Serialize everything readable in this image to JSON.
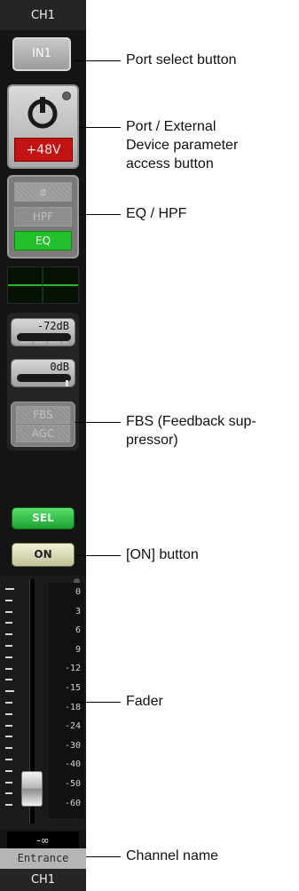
{
  "channel": {
    "label_top": "CH1",
    "label_bottom": "CH1",
    "port_button_label": "IN1",
    "phantom_label": "+48V",
    "eq": {
      "phase_label": "ø",
      "hpf_label": "HPF",
      "eq_label": "EQ"
    },
    "gain1_label": "-72dB",
    "gain2_label": "0dB",
    "fbs_label": "FBS",
    "agc_label": "AGC",
    "sel_label": "SEL",
    "on_label": "ON",
    "fader_scale": [
      "0",
      "3",
      "6",
      "9",
      "-12",
      "-15",
      "-18",
      "-24",
      "-30",
      "-40",
      "-50",
      "-60"
    ],
    "fader_value_label": "-∞",
    "channel_name": "Entrance",
    "colors": {
      "phantom": "#c41313",
      "eq_on": "#22c02a",
      "sel": "#2fbe44",
      "on": "#d8d7b4"
    }
  },
  "annotations": {
    "port_select": "Port select button",
    "port_external": "Port / External\nDevice parameter\naccess button",
    "eq_hpf": "EQ / HPF",
    "fbs": "FBS (Feedback sup-\npressor)",
    "on_button": "[ON] button",
    "fader": "Fader",
    "channel_name": "Channel name"
  }
}
